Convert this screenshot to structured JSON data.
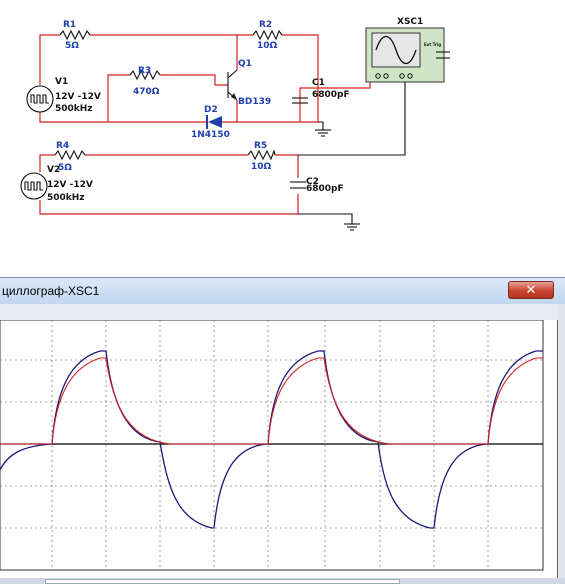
{
  "schematic": {
    "components": {
      "r1": {
        "ref": "R1",
        "value": "5Ω"
      },
      "r2": {
        "ref": "R2",
        "value": "10Ω"
      },
      "r3": {
        "ref": "R3",
        "value": "470Ω"
      },
      "r4": {
        "ref": "R4",
        "value": "5Ω"
      },
      "r5": {
        "ref": "R5",
        "value": "10Ω"
      },
      "q1": {
        "ref": "Q1",
        "value": "BD139"
      },
      "d2": {
        "ref": "D2",
        "value": "1N4150"
      },
      "c1": {
        "ref": "C1",
        "value": "6800pF"
      },
      "c2": {
        "ref": "C2",
        "value": "6800pF"
      },
      "v1": {
        "ref": "V1",
        "value": "12V -12V",
        "freq": "500kHz"
      },
      "v2": {
        "ref": "V2",
        "value": "12V -12V",
        "freq": "500kHz"
      },
      "xsc1": {
        "ref": "XSC1",
        "ext_trig": "Ext Trig"
      }
    },
    "colors": {
      "wire_red": "#d32020",
      "wire_black": "#111111",
      "label_blue": "#1f3fae"
    }
  },
  "oscilloscope_window": {
    "title": "циллограф-XSC1",
    "close_icon": "close-icon",
    "trace_colors": {
      "channel_a": "#d32020",
      "channel_b": "#1a1a7a"
    }
  }
}
